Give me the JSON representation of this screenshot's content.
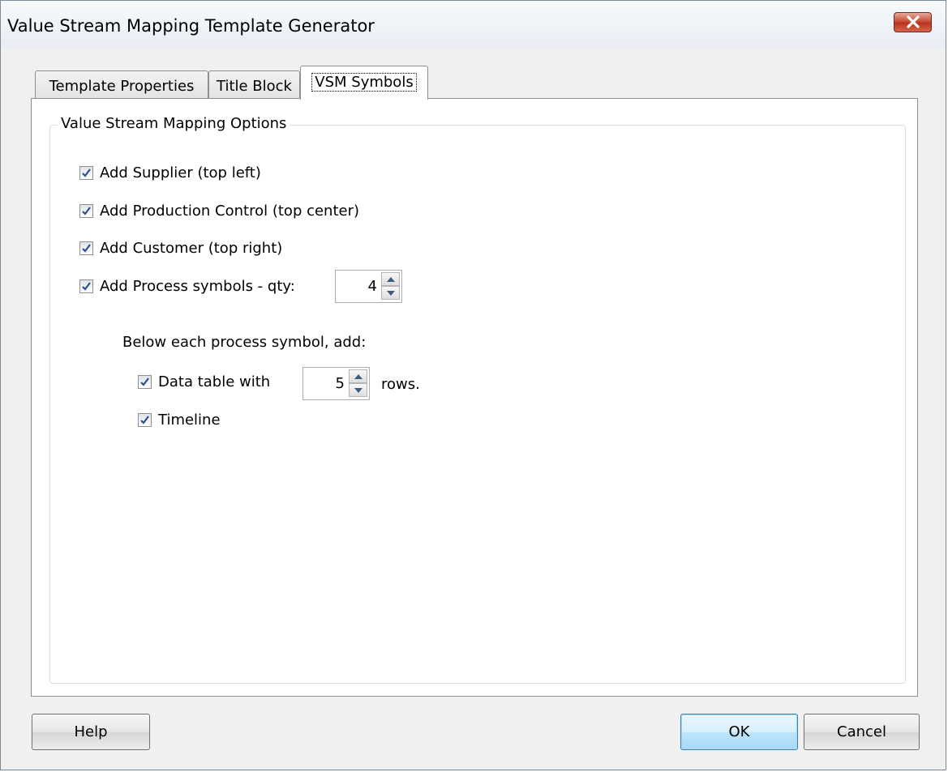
{
  "window": {
    "title": "Value Stream Mapping Template Generator"
  },
  "tabs": [
    {
      "label": "Template Properties",
      "active": false
    },
    {
      "label": "Title Block",
      "active": false
    },
    {
      "label": "VSM Symbols",
      "active": true
    }
  ],
  "group": {
    "legend": "Value Stream Mapping Options"
  },
  "options": {
    "supplier": {
      "label": "Add Supplier (top left)",
      "checked": true
    },
    "production_control": {
      "label": "Add Production Control (top center)",
      "checked": true
    },
    "customer": {
      "label": "Add Customer (top right)",
      "checked": true
    },
    "process": {
      "label": "Add Process symbols - qty:",
      "checked": true,
      "qty": "4"
    }
  },
  "below": {
    "heading": "Below each process symbol, add:",
    "data_table": {
      "label": "Data table with",
      "checked": true,
      "rows": "5",
      "suffix": "rows."
    },
    "timeline": {
      "label": "Timeline",
      "checked": true
    }
  },
  "buttons": {
    "help": "Help",
    "ok": "OK",
    "cancel": "Cancel"
  },
  "icons": {
    "close": "close-icon",
    "check": "checkmark-icon",
    "spin_up": "arrow-up-icon",
    "spin_down": "arrow-down-icon"
  }
}
